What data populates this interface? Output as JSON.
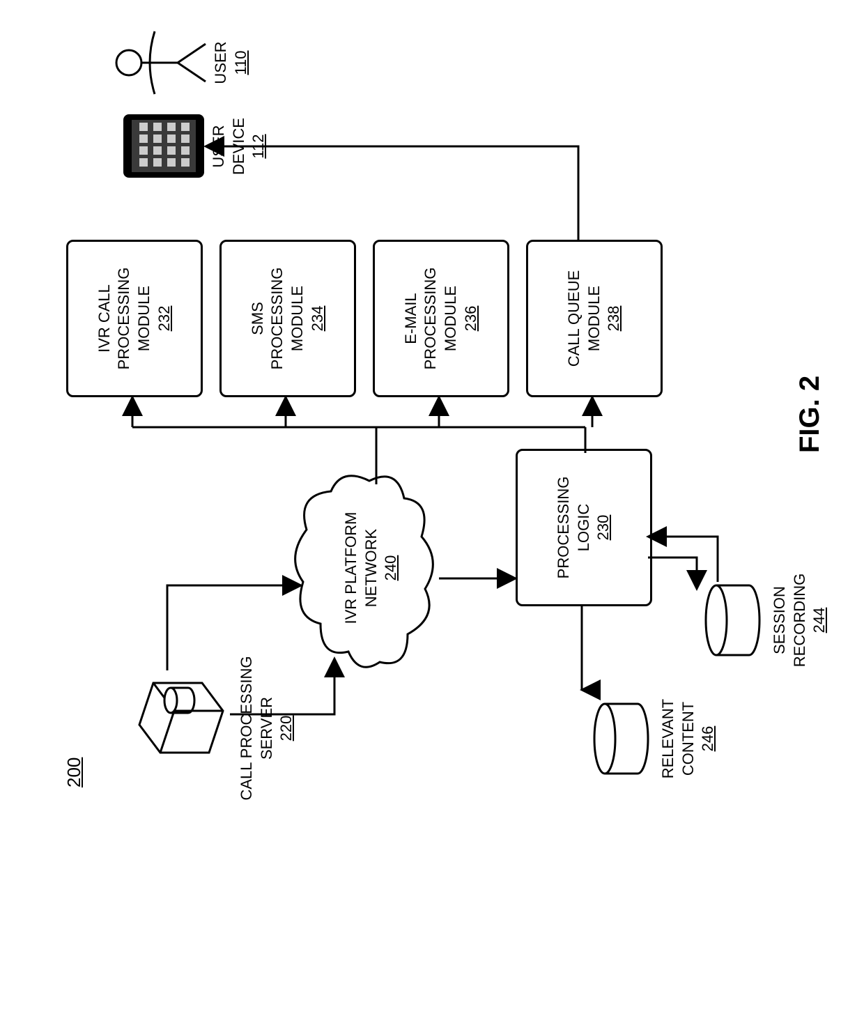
{
  "figure_ref": "200",
  "figure_label": "FIG. 2",
  "blocks": {
    "call_processing_server": {
      "line1": "CALL PROCESSING",
      "line2": "SERVER",
      "num": "220"
    },
    "ivr_platform_network": {
      "line1": "IVR PLATFORM",
      "line2": "NETWORK",
      "num": "240"
    },
    "processing_logic": {
      "line1": "PROCESSING",
      "line2": "LOGIC",
      "num": "230"
    },
    "relevant_content": {
      "line1": "RELEVANT",
      "line2": "CONTENT",
      "num": "246"
    },
    "session_recording": {
      "line1": "SESSION",
      "line2": "RECORDING",
      "num": "244"
    },
    "ivr_call_module": {
      "line1": "IVR CALL",
      "line2": "PROCESSING",
      "line3": "MODULE",
      "num": "232"
    },
    "sms_module": {
      "line1": "SMS",
      "line2": "PROCESSING",
      "line3": "MODULE",
      "num": "234"
    },
    "email_module": {
      "line1": "E-MAIL",
      "line2": "PROCESSING",
      "line3": "MODULE",
      "num": "236"
    },
    "call_queue_module": {
      "line1": "CALL QUEUE",
      "line2": "MODULE",
      "num": "238"
    },
    "user_device": {
      "line1": "USER",
      "line2": "DEVICE",
      "num": "112"
    },
    "user": {
      "line1": "USER",
      "num": "110"
    }
  }
}
